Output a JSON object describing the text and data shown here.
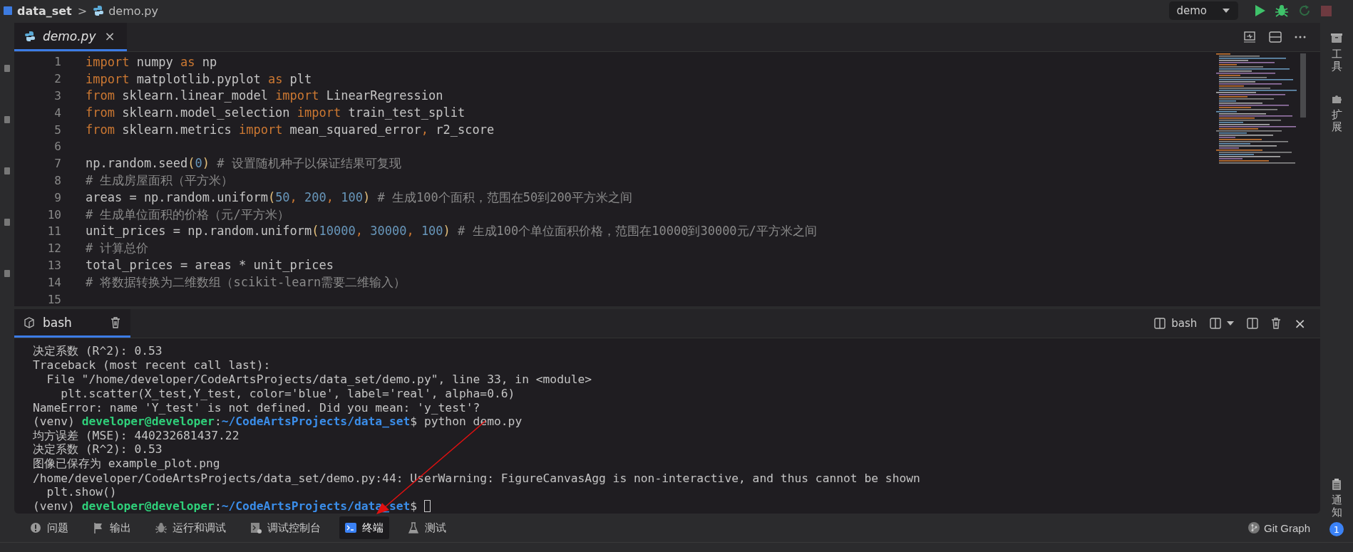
{
  "breadcrumb": {
    "separator": ">",
    "items": [
      {
        "kind": "folder",
        "label": "data_set"
      },
      {
        "kind": "python",
        "label": "demo.py"
      }
    ]
  },
  "run_config": {
    "label": "demo"
  },
  "editor": {
    "tabs": [
      {
        "label": "demo.py",
        "selected": true,
        "close": "×"
      }
    ],
    "lines": [
      {
        "number": "1",
        "tokens": [
          {
            "kind": "keyword",
            "text": "import"
          },
          {
            "kind": "plain",
            "text": " numpy "
          },
          {
            "kind": "keyword",
            "text": "as"
          },
          {
            "kind": "plain",
            "text": " np"
          }
        ]
      },
      {
        "number": "2",
        "tokens": [
          {
            "kind": "keyword",
            "text": "import"
          },
          {
            "kind": "plain",
            "text": " matplotlib.pyplot "
          },
          {
            "kind": "keyword",
            "text": "as"
          },
          {
            "kind": "plain",
            "text": " plt"
          }
        ]
      },
      {
        "number": "3",
        "tokens": [
          {
            "kind": "keyword",
            "text": "from"
          },
          {
            "kind": "plain",
            "text": " sklearn.linear_model "
          },
          {
            "kind": "keyword",
            "text": "import"
          },
          {
            "kind": "plain",
            "text": " LinearRegression"
          }
        ]
      },
      {
        "number": "4",
        "tokens": [
          {
            "kind": "keyword",
            "text": "from"
          },
          {
            "kind": "plain",
            "text": " sklearn.model_selection "
          },
          {
            "kind": "keyword",
            "text": "import"
          },
          {
            "kind": "plain",
            "text": " train_test_split"
          }
        ]
      },
      {
        "number": "5",
        "tokens": [
          {
            "kind": "keyword",
            "text": "from"
          },
          {
            "kind": "plain",
            "text": " sklearn.metrics "
          },
          {
            "kind": "keyword",
            "text": "import"
          },
          {
            "kind": "plain",
            "text": " mean_squared_error"
          },
          {
            "kind": "keyword",
            "text": ","
          },
          {
            "kind": "plain",
            "text": " r2_score"
          }
        ]
      },
      {
        "number": "6"
      },
      {
        "number": "7",
        "tokens": [
          {
            "kind": "plain",
            "text": "np.random.seed"
          },
          {
            "kind": "paren",
            "text": "("
          },
          {
            "kind": "number",
            "text": "0"
          },
          {
            "kind": "paren",
            "text": ")"
          },
          {
            "kind": "comment",
            "text": " # 设置随机种子以保证结果可复现"
          }
        ]
      },
      {
        "number": "8",
        "tokens": [
          {
            "kind": "comment",
            "text": "# 生成房屋面积（平方米）"
          }
        ]
      },
      {
        "number": "9",
        "tokens": [
          {
            "kind": "plain",
            "text": "areas = np.random.uniform"
          },
          {
            "kind": "paren",
            "text": "("
          },
          {
            "kind": "number",
            "text": "50"
          },
          {
            "kind": "keyword",
            "text": ", "
          },
          {
            "kind": "number",
            "text": "200"
          },
          {
            "kind": "keyword",
            "text": ", "
          },
          {
            "kind": "number",
            "text": "100"
          },
          {
            "kind": "paren",
            "text": ")"
          },
          {
            "kind": "comment",
            "text": " # 生成100个面积，范围在50到200平方米之间"
          }
        ]
      },
      {
        "number": "10",
        "tokens": [
          {
            "kind": "comment",
            "text": "# 生成单位面积的价格（元/平方米）"
          }
        ]
      },
      {
        "number": "11",
        "tokens": [
          {
            "kind": "plain",
            "text": "unit_prices = np.random.uniform"
          },
          {
            "kind": "paren",
            "text": "("
          },
          {
            "kind": "number",
            "text": "10000"
          },
          {
            "kind": "keyword",
            "text": ", "
          },
          {
            "kind": "number",
            "text": "30000"
          },
          {
            "kind": "keyword",
            "text": ", "
          },
          {
            "kind": "number",
            "text": "100"
          },
          {
            "kind": "paren",
            "text": ")"
          },
          {
            "kind": "comment",
            "text": " # 生成100个单位面积价格，范围在10000到30000元/平方米之间"
          }
        ]
      },
      {
        "number": "12",
        "tokens": [
          {
            "kind": "comment",
            "text": "# 计算总价"
          }
        ]
      },
      {
        "number": "13",
        "tokens": [
          {
            "kind": "plain",
            "text": "total_prices = areas * unit_prices"
          }
        ]
      },
      {
        "number": "14",
        "tokens": [
          {
            "kind": "comment",
            "text": "# 将数据转换为二维数组（scikit-learn需要二维输入）"
          }
        ]
      },
      {
        "number": "15"
      }
    ]
  },
  "terminal": {
    "tabs": [
      {
        "label": "bash",
        "selected": true
      }
    ],
    "shell_label": "bash",
    "close": "×",
    "lines": [
      {
        "tokens": [
          {
            "kind": "plain",
            "text": "决定系数 (R^2): 0.53"
          }
        ]
      },
      {
        "tokens": [
          {
            "kind": "plain",
            "text": "Traceback (most recent call last):"
          }
        ]
      },
      {
        "tokens": [
          {
            "kind": "plain",
            "text": "  File \"/home/developer/CodeArtsProjects/data_set/demo.py\", line 33, in <module>"
          }
        ]
      },
      {
        "tokens": [
          {
            "kind": "plain",
            "text": "    plt.scatter(X_test,Y_test, color='blue', label='real', alpha=0.6)"
          }
        ]
      },
      {
        "tokens": [
          {
            "kind": "plain",
            "text": "NameError: name 'Y_test' is not defined. Did you mean: 'y_test'?"
          }
        ]
      },
      {
        "tokens": [
          {
            "kind": "plain",
            "text": "(venv) "
          },
          {
            "kind": "user",
            "text": "developer@developer"
          },
          {
            "kind": "plain",
            "text": ":"
          },
          {
            "kind": "path",
            "text": "~/CodeArtsProjects/data_set"
          },
          {
            "kind": "plain",
            "text": "$ python demo.py"
          }
        ]
      },
      {
        "tokens": [
          {
            "kind": "plain",
            "text": "均方误差 (MSE): 440232681437.22"
          }
        ]
      },
      {
        "tokens": [
          {
            "kind": "plain",
            "text": "决定系数 (R^2): 0.53"
          }
        ]
      },
      {
        "tokens": [
          {
            "kind": "plain",
            "text": "图像已保存为 example_plot.png"
          }
        ]
      },
      {
        "tokens": [
          {
            "kind": "plain",
            "text": "/home/developer/CodeArtsProjects/data_set/demo.py:44: UserWarning: FigureCanvasAgg is non-interactive, and thus cannot be shown"
          }
        ]
      },
      {
        "tokens": [
          {
            "kind": "plain",
            "text": "  plt.show()"
          }
        ]
      },
      {
        "tokens": [
          {
            "kind": "plain",
            "text": "(venv) "
          },
          {
            "kind": "user",
            "text": "developer@developer"
          },
          {
            "kind": "plain",
            "text": ":"
          },
          {
            "kind": "path",
            "text": "~/CodeArtsProjects/data_set"
          },
          {
            "kind": "plain",
            "text": "$ "
          }
        ],
        "cursor": true
      }
    ]
  },
  "panel_tabs": [
    {
      "kind": "problems",
      "label": "问题",
      "selected": false
    },
    {
      "kind": "output",
      "label": "输出",
      "selected": false
    },
    {
      "kind": "debug",
      "label": "运行和调试",
      "selected": false
    },
    {
      "kind": "console",
      "label": "调试控制台",
      "selected": false
    },
    {
      "kind": "terminal",
      "label": "终端",
      "selected": true
    },
    {
      "kind": "test",
      "label": "测试",
      "selected": false
    }
  ],
  "git_graph": {
    "label": "Git Graph"
  },
  "right_sidebar": [
    {
      "kind": "tools",
      "label": "工具"
    },
    {
      "kind": "extensions",
      "label": "扩展"
    },
    {
      "kind": "notifications",
      "label": "通知",
      "badge": "1"
    }
  ]
}
